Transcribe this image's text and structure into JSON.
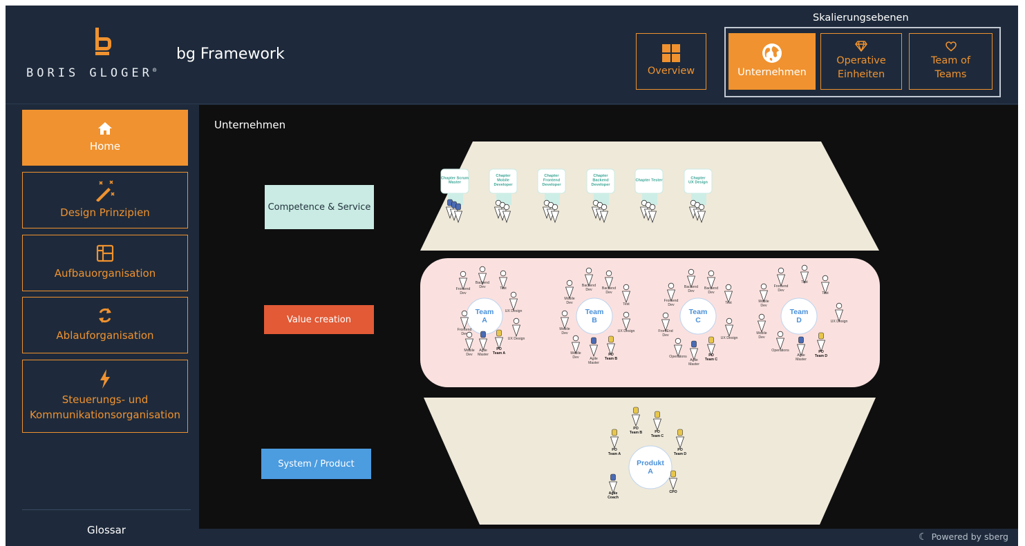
{
  "header": {
    "logo_text": "BORIS GLOGER",
    "logo_mark": "®",
    "app_title": "bg Framework",
    "nav_overview": "Overview",
    "scale_title": "Skalierungsebenen",
    "nav_unternehmen": "Unternehmen",
    "nav_operative": [
      "Operative",
      "Einheiten"
    ],
    "nav_teams": [
      "Team of",
      "Teams"
    ]
  },
  "sidebar": {
    "items": [
      {
        "label": "Home",
        "icon": "home-icon",
        "active": true
      },
      {
        "label": "Design Prinzipien",
        "icon": "magic-wand-icon"
      },
      {
        "label": "Aufbauorganisation",
        "icon": "layout-icon"
      },
      {
        "label": "Ablauforganisation",
        "icon": "refresh-icon"
      },
      {
        "label": [
          "Steuerungs- und",
          "Kommunikationsorganisation"
        ],
        "icon": "lightning-icon"
      }
    ],
    "glossar": "Glossar"
  },
  "main": {
    "title": "Unternehmen",
    "levels": {
      "competence": "Competence & Service",
      "value": "Value creation",
      "system": "System / Product"
    }
  },
  "diagram": {
    "chapters": [
      [
        "Chapter Scrum",
        "Master"
      ],
      [
        "Chapter",
        "Mobile",
        "Developer"
      ],
      [
        "Chapter",
        "Frontend",
        "Developer"
      ],
      [
        "Chapter",
        "Backend",
        "Developer"
      ],
      [
        "Chapter Tester"
      ],
      [
        "Chapter",
        "UX Design"
      ]
    ],
    "teams": [
      {
        "name": [
          "Team",
          "A"
        ]
      },
      {
        "name": [
          "Team",
          "B"
        ]
      },
      {
        "name": [
          "Team",
          "C"
        ]
      },
      {
        "name": [
          "Team",
          "D"
        ]
      }
    ],
    "roles": {
      "backend": [
        "Backend",
        "Dev"
      ],
      "frontend": [
        "Frontend",
        "Dev"
      ],
      "frontend_alt": [
        "FrontEnd",
        "Dev"
      ],
      "mobile": [
        "Mobile",
        "Dev"
      ],
      "test": "Test",
      "ux": "UX Design",
      "agile": [
        "Agile",
        "Master"
      ],
      "operations": "Operations",
      "po_a": [
        "PO",
        "Team A"
      ],
      "po_b": [
        "PO",
        "Team B"
      ],
      "po_c": [
        "PO",
        "Team C"
      ],
      "po_d": [
        "PO",
        "Team D"
      ],
      "agile_coach": [
        "Agile",
        "Coach"
      ],
      "cpo": "CPO"
    },
    "product": [
      "Produkt",
      "A"
    ]
  },
  "footer": {
    "powered": "Powered by sberg"
  },
  "colors": {
    "accent": "#f0922f",
    "background": "#1e2a3b",
    "canvas": "#0f0f10",
    "competence": "#c9ebe3",
    "value": "#e25a36",
    "system": "#4c9ce0",
    "beige": "#efe9da",
    "pink": "#fae1df"
  }
}
